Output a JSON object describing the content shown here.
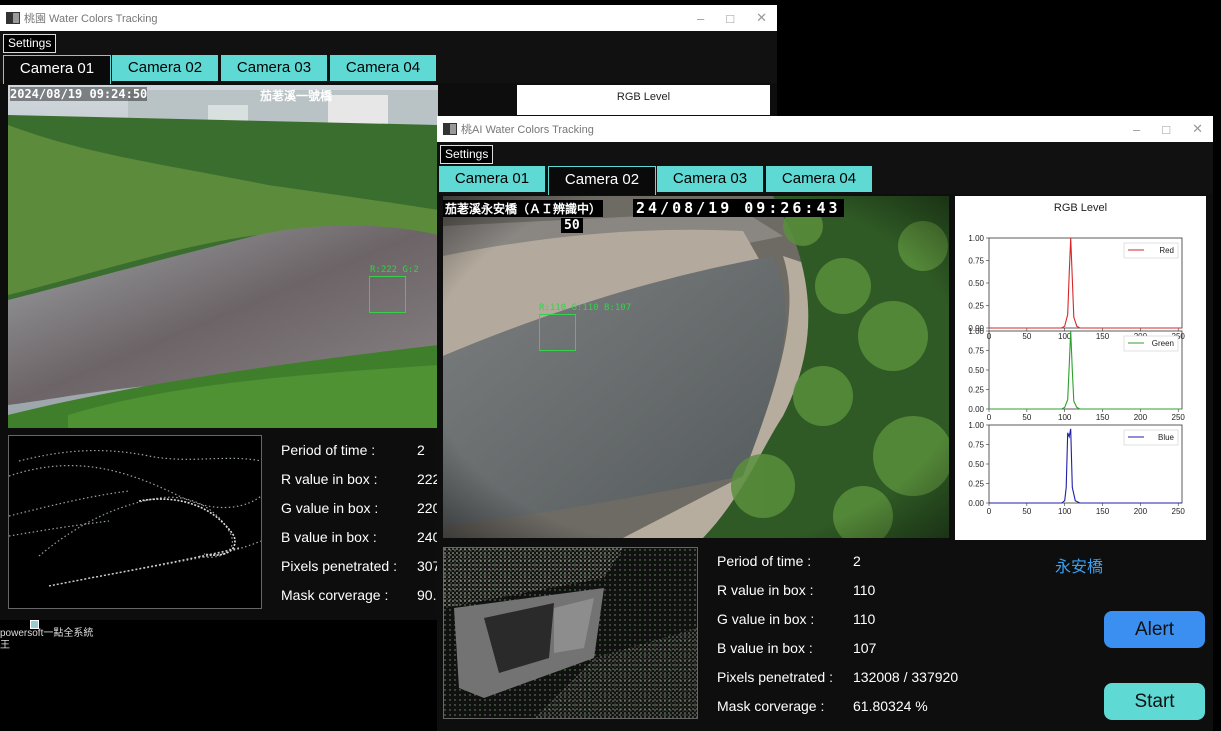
{
  "colors": {
    "tab": "#5fd9d4",
    "alert": "#3b8ff0",
    "start": "#5fd9d4",
    "bridge": "#3aa0f0",
    "red": "#d62728",
    "green": "#2ca02c",
    "blue": "#1f1fa8"
  },
  "win1": {
    "title": "桃園 Water Colors Tracking",
    "settings": "Settings",
    "tabs": [
      "Camera 01",
      "Camera 02",
      "Camera 03",
      "Camera 04"
    ],
    "timestamp": "2024/08/19 09:24:50",
    "location": "茄荖溪一號橋",
    "det_label": "R:222  G:2",
    "rgb_title": "RGB Level",
    "stats": [
      {
        "label": "Period of time :",
        "value": "2"
      },
      {
        "label": "R value in box :",
        "value": "222"
      },
      {
        "label": "G value in box :",
        "value": "220"
      },
      {
        "label": "B value in box :",
        "value": "240"
      },
      {
        "label": "Pixels penetrated :",
        "value": "307"
      },
      {
        "label": "Mask corverage :",
        "value": "90."
      }
    ]
  },
  "desktop_icon": {
    "label": "powersoft一點全系統\n王"
  },
  "win2": {
    "title": "桃AI Water Colors Tracking",
    "settings": "Settings",
    "tabs": [
      "Camera 01",
      "Camera 02",
      "Camera 03",
      "Camera 04"
    ],
    "stamp_line1": "茄荖溪永安橋（ＡＩ辨識中）",
    "stamp_date": "24/08/19  09:26:43",
    "stamp_line2": "50",
    "det_label": "R:110  G:110  B:107",
    "bridge_name": "永安橋",
    "alert": "Alert",
    "start": "Start",
    "stats": [
      {
        "label": "Period of time :",
        "value": "2"
      },
      {
        "label": "R value in box :",
        "value": "110"
      },
      {
        "label": "G value in box :",
        "value": "110"
      },
      {
        "label": "B value in box :",
        "value": "107"
      },
      {
        "label": "Pixels penetrated :",
        "value": "132008 / 337920"
      },
      {
        "label": "Mask corverage :",
        "value": "61.80324 %"
      }
    ]
  },
  "chart_data": {
    "type": "line",
    "title": "RGB Level",
    "x_ticks": [
      0,
      50,
      100,
      150,
      200,
      250
    ],
    "y_ticks": [
      0.0,
      0.25,
      0.5,
      0.75,
      1.0
    ],
    "xlim": [
      0,
      255
    ],
    "ylim": [
      0,
      1
    ],
    "series": [
      {
        "name": "Red",
        "peak": 108,
        "x": [
          0,
          96,
          100,
          104,
          106,
          108,
          110,
          112,
          116,
          120,
          255
        ],
        "values": [
          0,
          0,
          0.02,
          0.15,
          0.6,
          1.0,
          0.55,
          0.12,
          0.02,
          0,
          0
        ]
      },
      {
        "name": "Green",
        "peak": 108,
        "x": [
          0,
          96,
          100,
          104,
          106,
          108,
          110,
          112,
          116,
          120,
          255
        ],
        "values": [
          0,
          0,
          0.02,
          0.12,
          0.55,
          1.0,
          0.5,
          0.1,
          0.02,
          0,
          0
        ]
      },
      {
        "name": "Blue",
        "peak": 105,
        "x": [
          0,
          96,
          100,
          102,
          104,
          106,
          108,
          110,
          114,
          120,
          255
        ],
        "values": [
          0,
          0,
          0.03,
          0.2,
          0.9,
          0.85,
          0.95,
          0.2,
          0.03,
          0,
          0
        ]
      }
    ]
  }
}
